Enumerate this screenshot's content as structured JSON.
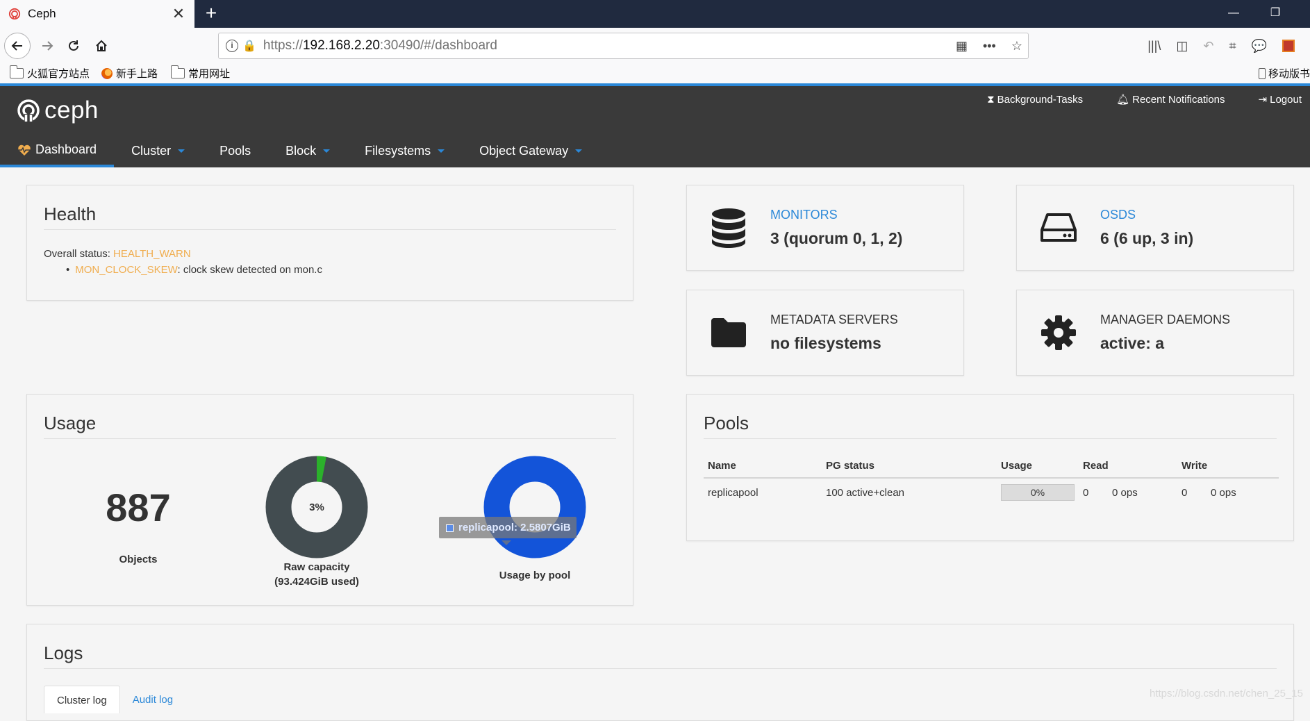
{
  "browser": {
    "tab_title": "Ceph",
    "url": {
      "scheme": "https://",
      "host": "192.168.2.20",
      "rest": ":30490/#/dashboard"
    },
    "bookmarks": [
      "火狐官方站点",
      "新手上路",
      "常用网址"
    ],
    "mobile_bookmarks": "移动版书"
  },
  "header": {
    "logo_text": "ceph",
    "links": {
      "tasks": "Background-Tasks",
      "notifications": "Recent Notifications",
      "logout": "Logout"
    },
    "nav": [
      {
        "label": "Dashboard",
        "active": true,
        "dropdown": false
      },
      {
        "label": "Cluster",
        "active": false,
        "dropdown": true
      },
      {
        "label": "Pools",
        "active": false,
        "dropdown": false
      },
      {
        "label": "Block",
        "active": false,
        "dropdown": true
      },
      {
        "label": "Filesystems",
        "active": false,
        "dropdown": true
      },
      {
        "label": "Object Gateway",
        "active": false,
        "dropdown": true
      }
    ]
  },
  "health": {
    "title": "Health",
    "overall_label": "Overall status: ",
    "overall_status": "HEALTH_WARN",
    "checks": [
      {
        "code": "MON_CLOCK_SKEW",
        "message": ": clock skew detected on mon.c"
      }
    ]
  },
  "cards": {
    "monitors": {
      "label": "MONITORS",
      "value": "3 (quorum 0, 1, 2)",
      "icon": "database-icon"
    },
    "osds": {
      "label": "OSDS",
      "value": "6 (6 up, 3 in)",
      "icon": "hdd-icon"
    },
    "mds": {
      "label": "METADATA SERVERS",
      "value": "no filesystems",
      "icon": "folder-icon"
    },
    "mgr": {
      "label": "MANAGER DAEMONS",
      "value": "active: a",
      "icon": "gear-icon"
    }
  },
  "usage": {
    "title": "Usage",
    "objects_count": "887",
    "objects_label": "Objects",
    "raw_capacity": {
      "percent_label": "3%",
      "used_fraction": 0.03,
      "label": "Raw capacity",
      "sublabel": "(93.424GiB used)"
    },
    "by_pool": {
      "label": "Usage by pool",
      "tooltip": "replicapool: 2.5807GiB"
    }
  },
  "pools": {
    "title": "Pools",
    "columns": [
      "Name",
      "PG status",
      "Usage",
      "Read",
      "Write"
    ],
    "rows": [
      {
        "name": "replicapool",
        "pg_status": "100 active+clean",
        "usage": "0%",
        "read_n": "0",
        "read_ops": "0 ops",
        "write_n": "0",
        "write_ops": "0 ops"
      }
    ]
  },
  "logs": {
    "title": "Logs",
    "tabs": [
      "Cluster log",
      "Audit log"
    ]
  },
  "watermark": "https://blog.csdn.net/chen_25_15",
  "colors": {
    "accent": "#2b88d8",
    "header_bg": "#3a3a3a",
    "warn": "#f0ad4e",
    "ok": "#5cb85c",
    "raw_used": "#2bb12b",
    "raw_free": "#424c50",
    "pool": "#1354d9"
  }
}
